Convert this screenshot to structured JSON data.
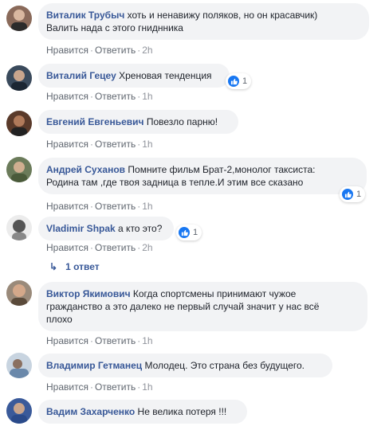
{
  "comments": [
    {
      "author": "Виталик Трубыч",
      "text": "хоть и ненавижу поляков, но он красавчик)",
      "text2": "Валить нада с этого гниднника",
      "like": "Нравится",
      "reply": "Ответить",
      "time": "2h"
    },
    {
      "author": "Виталий Гецеу",
      "text": "Хреновая тенденция",
      "like": "Нравится",
      "reply": "Ответить",
      "time": "1h",
      "reactions": "1"
    },
    {
      "author": "Евгений Евгеньевич",
      "text": "Повезло парню!",
      "like": "Нравится",
      "reply": "Ответить",
      "time": "1h"
    },
    {
      "author": "Андрей Суханов",
      "text": "Помните фильм Брат-2,монолог таксиста:",
      "text2": "Родина там ,где твоя задница в тепле.И этим все сказано",
      "like": "Нравится",
      "reply": "Ответить",
      "time": "1h",
      "reactions": "1"
    },
    {
      "author": "Vladimir Shpak",
      "text": "а кто это?",
      "like": "Нравится",
      "reply": "Ответить",
      "time": "2h",
      "reactions": "1",
      "replies": "1 ответ"
    },
    {
      "author": "Виктор Якимович",
      "text": "Когда спортсмены принимают чужое",
      "text2": "гражданство а это далеко не первый случай значит у нас всё",
      "text3": "плохо",
      "like": "Нравится",
      "reply": "Ответить",
      "time": "1h"
    },
    {
      "author": "Владимир Гетманец",
      "text": "Молодец. Это страна без будущего.",
      "like": "Нравится",
      "reply": "Ответить",
      "time": "1h"
    },
    {
      "author": "Вадим Захарченко",
      "text": "Не велика потеря !!!"
    }
  ],
  "colors": {
    "author": "#385898",
    "bubble": "#f2f3f5",
    "meta": "#90949c",
    "like": "#1877f2"
  }
}
